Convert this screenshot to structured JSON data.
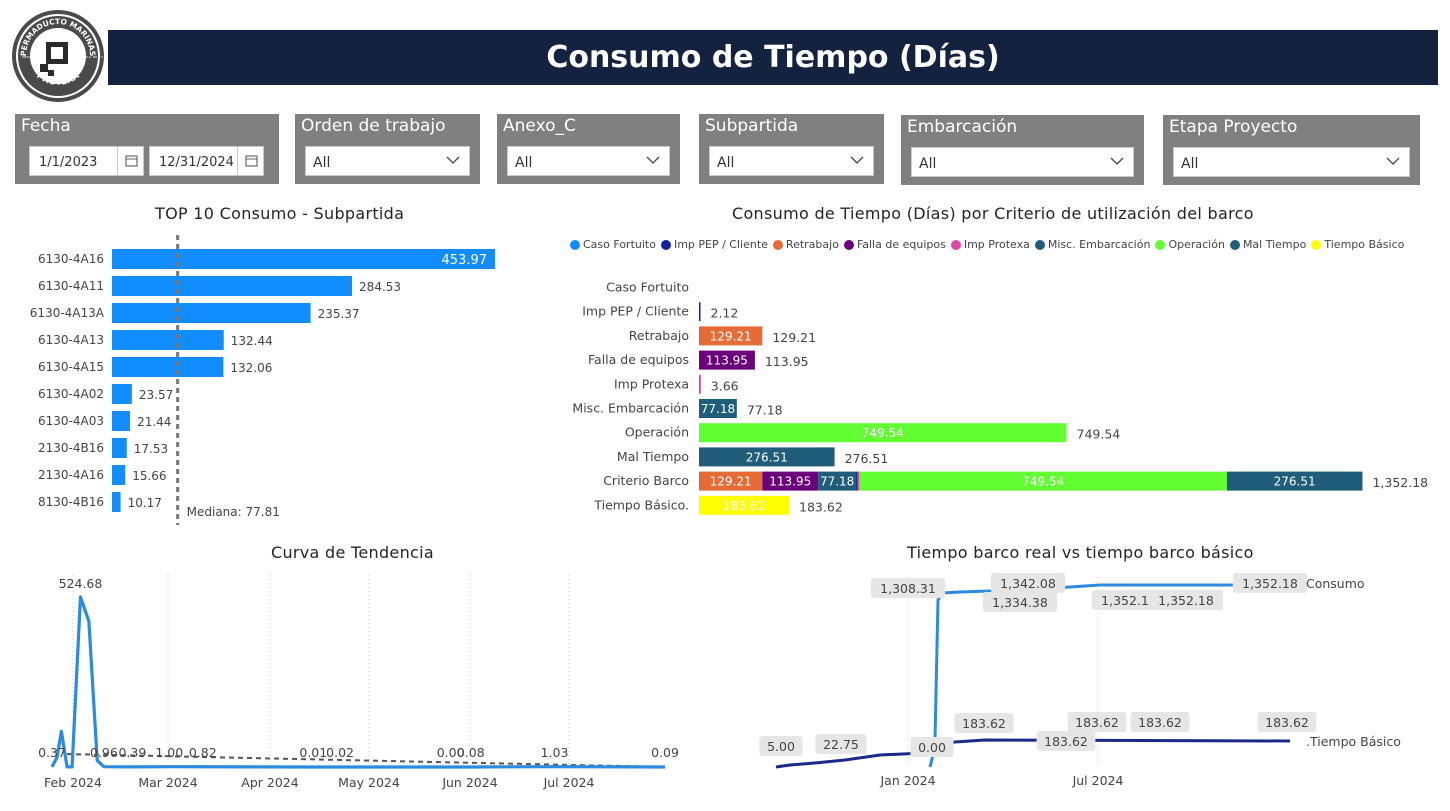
{
  "logo": {
    "text_top": "PERMADUCTO MARINAS",
    "text_bottom": "PROTEXA",
    "text_left": "MEXICO",
    "text_right": "S.A. DE C.V."
  },
  "header": {
    "title": "Consumo de Tiempo (Días)"
  },
  "filters": {
    "fecha": {
      "label": "Fecha",
      "start": "1/1/2023",
      "end": "12/31/2024"
    },
    "orden": {
      "label": "Orden de trabajo",
      "value": "All"
    },
    "anexo": {
      "label": "Anexo_C",
      "value": "All"
    },
    "subpartida": {
      "label": "Subpartida",
      "value": "All"
    },
    "embarcacion": {
      "label": "Embarcación",
      "value": "All"
    },
    "etapa": {
      "label": "Etapa Proyecto",
      "value": "All"
    }
  },
  "colors": {
    "title_bg": "#13233f",
    "slicer_bg": "#808080",
    "bar_blue": "#118DFF",
    "dark_blue": "#12239E",
    "orange": "#E66C37",
    "purple": "#6B007B",
    "pink": "#E044A7",
    "teal": "#1F5D7A",
    "green": "#62FF33",
    "yellow": "#FFFF00"
  },
  "chart_data": [
    {
      "type": "bar",
      "orientation": "horizontal",
      "title": "TOP 10 Consumo - Subpartida",
      "categories": [
        "6130-4A16",
        "6130-4A11",
        "6130-4A13A",
        "6130-4A13",
        "6130-4A15",
        "6130-4A02",
        "6130-4A03",
        "2130-4B16",
        "2130-4A16",
        "8130-4B16"
      ],
      "values": [
        453.97,
        284.53,
        235.37,
        132.44,
        132.06,
        23.57,
        21.44,
        17.53,
        15.66,
        10.17
      ],
      "labels": [
        "453.97",
        "284.53",
        "235.37",
        "132.44",
        "132.06",
        "23.57",
        "21.44",
        "17.53",
        "15.66",
        "10.17"
      ],
      "median": 77.81,
      "median_label": "Mediana: 77.81",
      "xlim": [
        0,
        500
      ]
    },
    {
      "type": "bar",
      "orientation": "horizontal",
      "stacked": true,
      "title": "Consumo de Tiempo (Días) por Criterio de utilización del barco",
      "legend": [
        {
          "name": "Caso Fortuito",
          "color": "#118DFF"
        },
        {
          "name": "Imp PEP / Cliente",
          "color": "#12239E"
        },
        {
          "name": "Retrabajo",
          "color": "#E66C37"
        },
        {
          "name": "Falla de equipos",
          "color": "#6B007B"
        },
        {
          "name": "Imp Protexa",
          "color": "#E044A7"
        },
        {
          "name": "Misc. Embarcación",
          "color": "#1F5D7A"
        },
        {
          "name": "Operación",
          "color": "#62FF33"
        },
        {
          "name": "Mal Tiempo",
          "color": "#1F5D7A"
        },
        {
          "name": "Tiempo Básico",
          "color": "#FFFF00"
        }
      ],
      "categories": [
        "Caso Fortuito",
        "Imp PEP / Cliente",
        "Retrabajo",
        "Falla de equipos",
        "Imp Protexa",
        "Misc. Embarcación",
        "Operación",
        "Mal Tiempo",
        "Criterio Barco",
        "Tiempo Básico."
      ],
      "rows": [
        {
          "segments": [],
          "total_label": ""
        },
        {
          "segments": [
            {
              "value": 2.12,
              "color": "#12239E",
              "label": ""
            }
          ],
          "total_label": "2.12"
        },
        {
          "segments": [
            {
              "value": 129.21,
              "color": "#E66C37",
              "label": "129.21"
            }
          ],
          "total_label": "129.21"
        },
        {
          "segments": [
            {
              "value": 113.95,
              "color": "#6B007B",
              "label": "113.95"
            }
          ],
          "total_label": "113.95"
        },
        {
          "segments": [
            {
              "value": 3.66,
              "color": "#E044A7",
              "label": ""
            }
          ],
          "total_label": "3.66"
        },
        {
          "segments": [
            {
              "value": 77.18,
              "color": "#1F5D7A",
              "label": "77.18"
            }
          ],
          "total_label": "77.18"
        },
        {
          "segments": [
            {
              "value": 749.54,
              "color": "#62FF33",
              "label": "749.54"
            }
          ],
          "total_label": "749.54"
        },
        {
          "segments": [
            {
              "value": 276.51,
              "color": "#1F5D7A",
              "label": "276.51"
            }
          ],
          "total_label": "276.51"
        },
        {
          "segments": [
            {
              "value": 129.21,
              "color": "#E66C37",
              "label": "129.21"
            },
            {
              "value": 113.95,
              "color": "#6B007B",
              "label": "113.95"
            },
            {
              "value": 77.18,
              "color": "#1F5D7A",
              "label": "77.18"
            },
            {
              "value": 2.12,
              "color": "#12239E",
              "label": ""
            },
            {
              "value": 3.66,
              "color": "#E044A7",
              "label": ""
            },
            {
              "value": 749.54,
              "color": "#62FF33",
              "label": "749.54"
            },
            {
              "value": 276.51,
              "color": "#1F5D7A",
              "label": "276.51"
            }
          ],
          "total_label": "1,352.18"
        },
        {
          "segments": [
            {
              "value": 183.62,
              "color": "#FFFF00",
              "label": "183.62"
            }
          ],
          "total_label": "183.62"
        }
      ],
      "xlim": [
        0,
        1352.18
      ]
    },
    {
      "type": "line",
      "title": "Curva de Tendencia",
      "x_ticks": [
        "Feb 2024",
        "Mar 2024",
        "Apr 2024",
        "May 2024",
        "Jun 2024",
        "Jul 2024"
      ],
      "series": [
        {
          "points": [
            [
              0.0,
              0.37
            ],
            [
              0.15,
              30
            ],
            [
              0.28,
              110
            ],
            [
              0.45,
              0.37
            ],
            [
              0.6,
              0.37
            ],
            [
              0.85,
              524.68
            ],
            [
              1.1,
              450
            ],
            [
              1.35,
              20
            ],
            [
              1.55,
              0.96
            ],
            [
              2.4,
              0.39
            ],
            [
              3.5,
              1.0
            ],
            [
              4.5,
              0.82
            ],
            [
              7.8,
              0.01
            ],
            [
              8.6,
              0.02
            ],
            [
              12.0,
              0.0
            ],
            [
              12.4,
              0.08
            ],
            [
              15.0,
              1.03
            ],
            [
              18.3,
              0.09
            ]
          ]
        }
      ],
      "trend": {
        "from": [
          0.45,
          40
        ],
        "to": [
          18.3,
          0
        ]
      },
      "data_labels": [
        {
          "text": "524.68",
          "x": 0.85,
          "y": 524.68
        },
        {
          "text": "0.37",
          "x": 0.0,
          "y": 0.37
        },
        {
          "text": "0.96",
          "x": 1.55,
          "y": 0.96
        },
        {
          "text": "0.39",
          "x": 2.4,
          "y": 0.39
        },
        {
          "text": "1.00",
          "x": 3.5,
          "y": 1.0
        },
        {
          "text": "0.82",
          "x": 4.5,
          "y": 0.82
        },
        {
          "text": "0.01",
          "x": 7.8,
          "y": 0.01
        },
        {
          "text": "0.02",
          "x": 8.6,
          "y": 0.02
        },
        {
          "text": "0.00",
          "x": 11.9,
          "y": 0.0
        },
        {
          "text": "0.08",
          "x": 12.5,
          "y": 0.08
        },
        {
          "text": "1.03",
          "x": 15.0,
          "y": 1.03
        },
        {
          "text": "0.09",
          "x": 18.3,
          "y": 0.09
        }
      ],
      "ylim": [
        0,
        560
      ]
    },
    {
      "type": "line",
      "title": "Tiempo barco real vs tiempo barco básico",
      "x_ticks": [
        "Jan 2024",
        "Jul 2024"
      ],
      "series": [
        {
          "name": "Consumo",
          "color": "#2B8BE0",
          "points": [
            [
              0,
              1280
            ],
            [
              1,
              1280
            ],
            [
              2,
              1290
            ],
            [
              3,
              1300
            ],
            [
              4,
              1308.31
            ],
            [
              4.3,
              1310
            ],
            [
              5,
              1334.38
            ],
            [
              6,
              1342.08
            ],
            [
              7,
              1350
            ],
            [
              8,
              1352.18
            ],
            [
              9,
              1352.18
            ],
            [
              10,
              1352.18
            ],
            [
              11,
              1352.18
            ]
          ]
        },
        {
          "name": "Tiempo Básico",
          "color": "#1A2A8A",
          "points": [
            [
              -5,
              5.0
            ],
            [
              -3.8,
              8
            ],
            [
              -2.8,
              22.75
            ],
            [
              -1.5,
              40
            ],
            [
              -0.3,
              60
            ],
            [
              0,
              92
            ],
            [
              1,
              160
            ],
            [
              2,
              175
            ],
            [
              3,
              183.62
            ],
            [
              8,
              183.62
            ],
            [
              11,
              183.62
            ]
          ]
        }
      ],
      "data_labels": [
        {
          "text": "1,308.31",
          "x": 0,
          "y": 1308.31
        },
        {
          "text": "1,342.08",
          "x": 1.5,
          "y": 1342.08
        },
        {
          "text": "1,334.38",
          "x": 1.5,
          "y": 1334.38
        },
        {
          "text": "1,352.18",
          "x": 3.5,
          "y": 1352.18
        },
        {
          "text": "1,352.18",
          "x": 5.5,
          "y": 1352.18
        },
        {
          "text": "1,352.18",
          "x": 8.5,
          "y": 1352.18
        },
        {
          "text": "5.00",
          "x": -5,
          "y": 5.0
        },
        {
          "text": "22.75",
          "x": -2.8,
          "y": 22.75
        },
        {
          "text": "0.00",
          "x": 0,
          "y": 0
        },
        {
          "text": "183.62",
          "x": 2,
          "y": 183.62
        },
        {
          "text": "183.62",
          "x": 4.5,
          "y": 183.62
        },
        {
          "text": "183.62",
          "x": 5.3,
          "y": 183.62
        },
        {
          "text": "183.62",
          "x": 6.3,
          "y": 183.62
        },
        {
          "text": "183.62",
          "x": 9.5,
          "y": 183.62
        }
      ],
      "series_labels": [
        "Consumo",
        ".Tiempo Básico"
      ]
    }
  ]
}
